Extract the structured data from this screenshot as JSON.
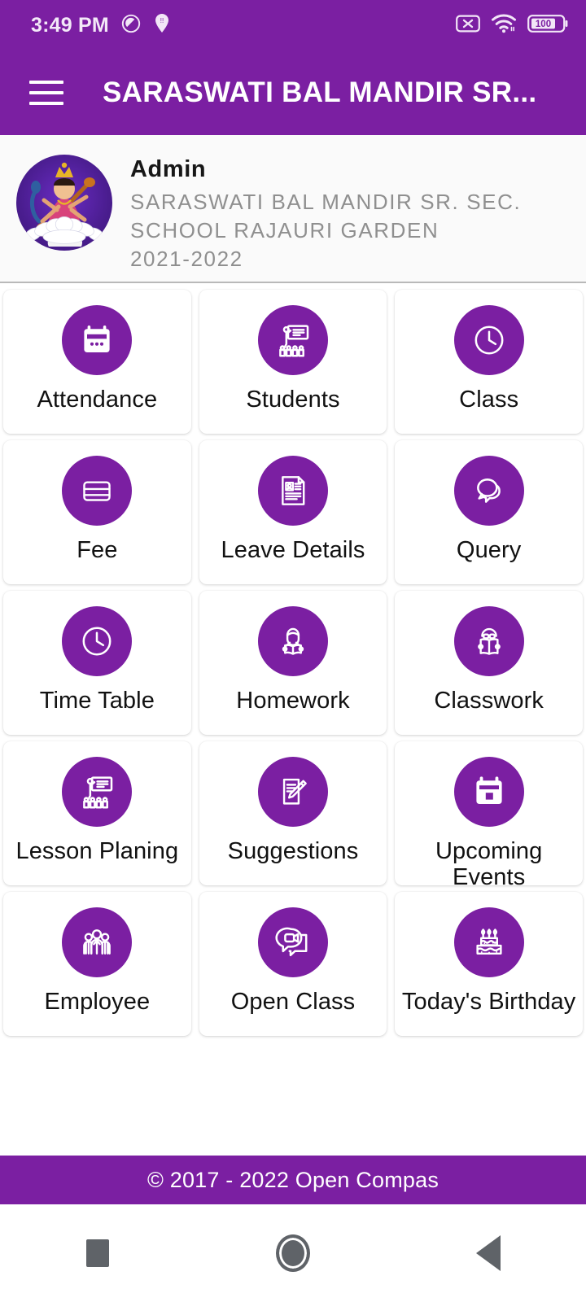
{
  "status_bar": {
    "time": "3:49 PM",
    "left_icons": [
      "do-not-disturb-icon",
      "location-pin-icon"
    ],
    "right_icons": [
      "no-sim-icon",
      "wifi-icon",
      "battery-icon"
    ],
    "battery_level": "100"
  },
  "app_bar": {
    "menu_icon": "hamburger-menu-icon",
    "title": "SARASWATI BAL MANDIR SR..."
  },
  "profile": {
    "avatar_icon": "saraswati-avatar",
    "name": "Admin",
    "school": "SARASWATI BAL MANDIR SR. SEC. SCHOOL RAJAURI GARDEN",
    "session": "2021-2022"
  },
  "colors": {
    "primary": "#7B1FA2",
    "app_bar": "#7B1FA2",
    "footer": "#7B1FA2",
    "tile_background": "#FFFFFF",
    "profile_background": "#FAFAFA",
    "label_text": "#111111",
    "muted_text": "#8F8F8F"
  },
  "menu": {
    "tiles": [
      {
        "label": "Attendance",
        "icon": "calendar-icon"
      },
      {
        "label": "Students",
        "icon": "teacher-board-students-icon"
      },
      {
        "label": "Class",
        "icon": "clock-icon"
      },
      {
        "label": "Fee",
        "icon": "credit-card-icon"
      },
      {
        "label": "Leave Details",
        "icon": "id-document-icon"
      },
      {
        "label": "Query",
        "icon": "chat-bubbles-icon"
      },
      {
        "label": "Time Table",
        "icon": "clock-icon"
      },
      {
        "label": "Homework",
        "icon": "student-reading-icon"
      },
      {
        "label": "Classwork",
        "icon": "person-open-book-icon"
      },
      {
        "label": "Lesson Planing",
        "icon": "teacher-board-students-icon"
      },
      {
        "label": "Suggestions",
        "icon": "notepad-pencil-icon"
      },
      {
        "label": "Upcoming Events",
        "icon": "calendar-event-icon"
      },
      {
        "label": "Employee",
        "icon": "people-group-icon"
      },
      {
        "label": "Open Class",
        "icon": "video-chat-icon"
      },
      {
        "label": "Today's Birthday",
        "icon": "birthday-cake-icon"
      }
    ]
  },
  "footer": {
    "copyright": "© 2017 - 2022 Open Compas"
  },
  "nav_bar": {
    "recents_icon": "square-recents-icon",
    "home_icon": "circle-home-icon",
    "back_icon": "triangle-back-icon"
  }
}
